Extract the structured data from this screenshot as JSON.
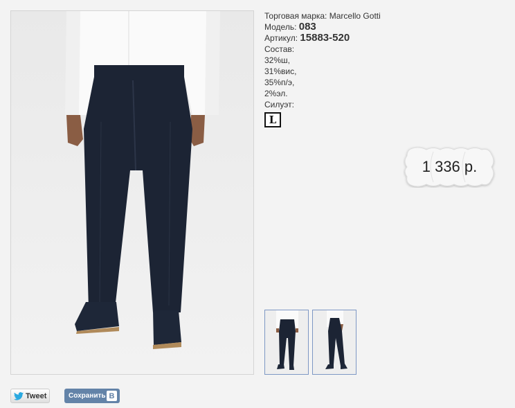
{
  "product": {
    "brand_label": "Торговая марка:",
    "brand_value": "Marcello Gotti",
    "model_label": "Модель:",
    "model_value": "083",
    "article_label": "Артикул:",
    "article_value": "15883-520",
    "composition_label": "Состав:",
    "composition": [
      "32%ш,",
      "31%вис,",
      "35%п/э,",
      "2%эл."
    ],
    "silhouette_label": "Силуэт:",
    "silhouette_value": "L",
    "price": "1 336 р."
  },
  "share": {
    "tweet_label": "Tweet",
    "vk_label": "Сохранить",
    "vk_logo": "В"
  },
  "colors": {
    "thumb_border": "#7d97c4",
    "vk_button": "#6383a8",
    "trousers": "#1c2434"
  },
  "icons": [
    "twitter-bird-icon",
    "vk-logo-icon",
    "silhouette-l-icon",
    "price-tag-icon"
  ]
}
